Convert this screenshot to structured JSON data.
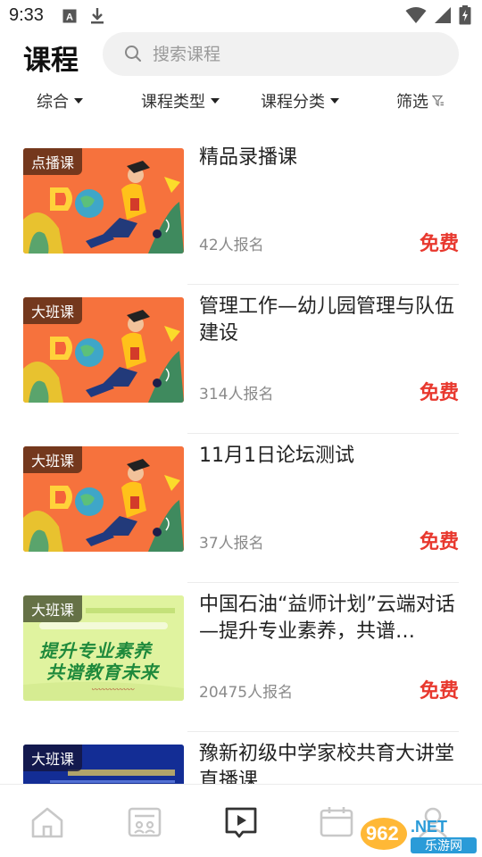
{
  "status_bar": {
    "time": "9:33"
  },
  "header": {
    "title": "课程",
    "search_placeholder": "搜索课程"
  },
  "filters": [
    {
      "label": "综合"
    },
    {
      "label": "课程类型"
    },
    {
      "label": "课程分类"
    },
    {
      "label": "筛选"
    }
  ],
  "courses": [
    {
      "badge": "点播课",
      "title": "精品录播课",
      "enrolled": "42人报名",
      "price": "免费",
      "thumb": "graduate-illustration"
    },
    {
      "badge": "大班课",
      "title": "管理工作—幼儿园管理与队伍建设",
      "enrolled": "314人报名",
      "price": "免费",
      "thumb": "graduate-illustration"
    },
    {
      "badge": "大班课",
      "title": "11月1日论坛测试",
      "enrolled": "37人报名",
      "price": "免费",
      "thumb": "graduate-illustration"
    },
    {
      "badge": "大班课",
      "title": "中国石油“益师计划”云端对话—提升专业素养，共谱…",
      "enrolled": "20475人报名",
      "price": "免费",
      "thumb": "green-banner",
      "thumb_text": {
        "line1": "提升专业素养",
        "line2": "共谱教育未来"
      }
    },
    {
      "badge": "大班课",
      "title": "豫新初级中学家校共育大讲堂直播课",
      "enrolled": "",
      "price": "",
      "thumb": "blue-banner"
    }
  ],
  "bottom_nav": [
    {
      "icon": "home-icon",
      "active": false
    },
    {
      "icon": "classroom-icon",
      "active": false
    },
    {
      "icon": "course-play-icon",
      "active": true
    },
    {
      "icon": "calendar-icon",
      "active": false
    },
    {
      "icon": "profile-icon",
      "active": false
    }
  ],
  "watermark": {
    "text": "962.NET",
    "subtext": "乐游网"
  },
  "colors": {
    "accent_red": "#e8382e",
    "nav_active": "#333333",
    "nav_inactive": "#c8c8c8"
  }
}
